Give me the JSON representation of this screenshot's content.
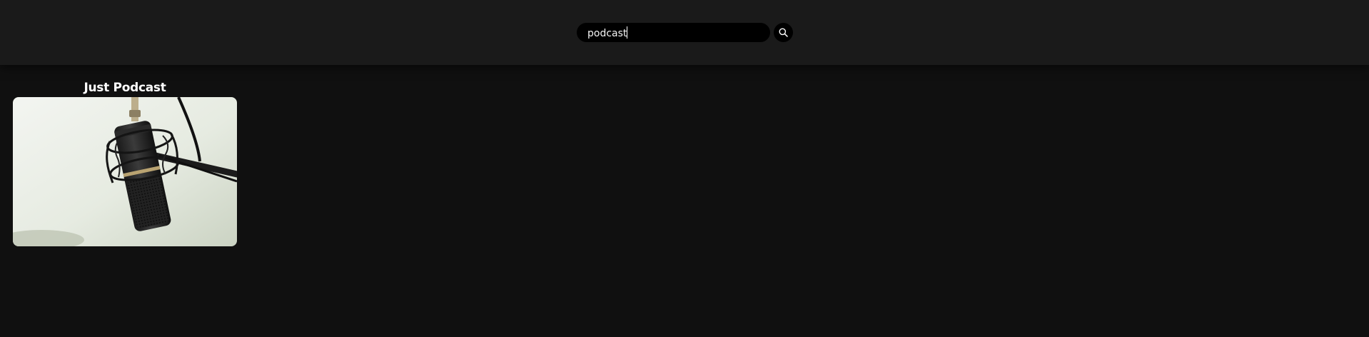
{
  "search": {
    "value": "podcast",
    "button_icon": "search-icon"
  },
  "results": [
    {
      "title": "Just Podcast",
      "image_icon": "microphone-image"
    }
  ],
  "colors": {
    "page_background": "#101010",
    "header_background": "#1a1a1a",
    "input_background": "#000000",
    "text": "#ffffff"
  }
}
